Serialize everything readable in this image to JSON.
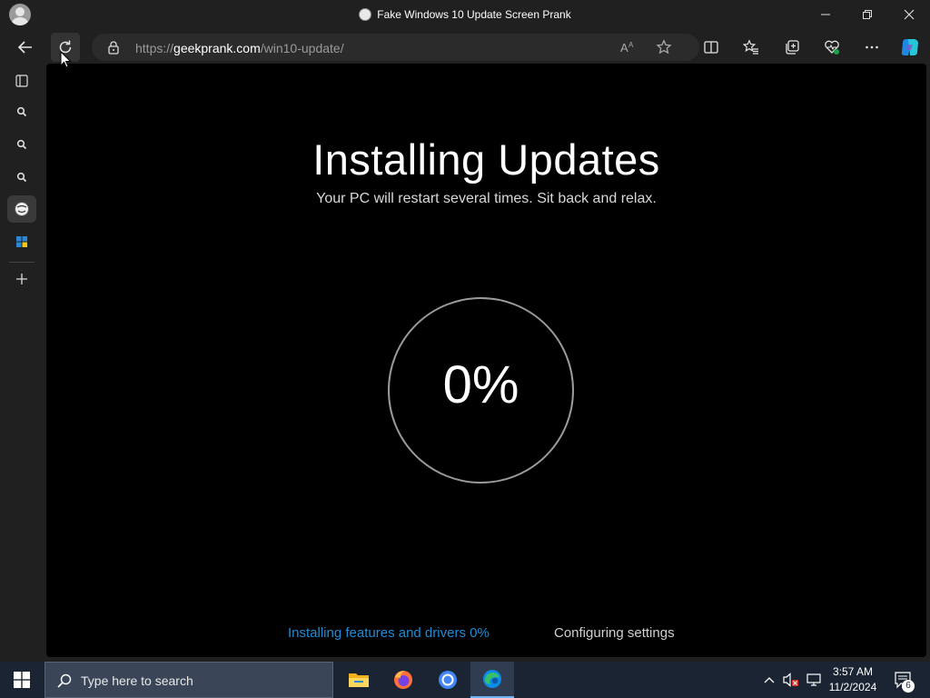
{
  "window": {
    "title": "Fake Windows 10 Update Screen Prank",
    "controls": [
      "minimize",
      "restore",
      "close"
    ]
  },
  "toolbar": {
    "url_scheme": "https://",
    "url_domain": "geekprank.com",
    "url_path": "/win10-update/",
    "icons": [
      "back-icon",
      "refresh-icon",
      "lock-icon",
      "read-aloud-icon",
      "favorite-star-icon",
      "split-screen-icon",
      "favorites-icon",
      "collections-icon",
      "browser-essentials-icon",
      "more-icon",
      "copilot-icon"
    ]
  },
  "sidebar": {
    "icons": [
      "tab-actions-icon",
      "search-icon",
      "search-icon",
      "search-icon",
      "geekprank-icon",
      "windows-app-icon",
      "add-icon"
    ]
  },
  "page": {
    "heading": "Installing Updates",
    "subheading": "Your PC will restart several times. Sit back and relax.",
    "percent": "0%",
    "progress_value": 0,
    "status_left": "Installing features and drivers 0%",
    "status_right": "Configuring settings"
  },
  "taskbar": {
    "search_placeholder": "Type here to search",
    "apps": [
      "file-explorer-icon",
      "firefox-icon",
      "chrome-icon",
      "edge-icon"
    ],
    "time": "3:57 AM",
    "date": "11/2/2024",
    "notifications_count": "6"
  },
  "colors": {
    "chrome_bg": "#202020",
    "page_bg": "#000000",
    "status_accent": "#1e8cd8",
    "taskbar_bg": "#1b2433"
  }
}
